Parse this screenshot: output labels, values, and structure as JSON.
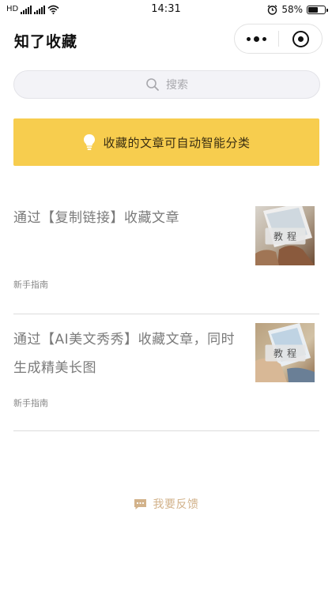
{
  "status_bar": {
    "signal_left_text": "HD",
    "time": "14:31",
    "battery_percent": "58%",
    "battery_level": 0.58,
    "alarm_icon": "alarm-icon",
    "wifi_icon": "wifi-icon"
  },
  "nav": {
    "title": "知了收藏",
    "more_icon": "more-dots-icon",
    "close_icon": "target-close-icon"
  },
  "search": {
    "placeholder": "搜索",
    "icon": "search-icon"
  },
  "banner": {
    "text": "收藏的文章可自动智能分类",
    "icon": "lightbulb-icon",
    "color": "#f7cd4e"
  },
  "articles": [
    {
      "title": "通过【复制链接】收藏文章",
      "tag": "新手指南",
      "thumb_badge": "教程"
    },
    {
      "title": "通过【AI美文秀秀】收藏文章，同时生成精美长图",
      "tag": "新手指南",
      "thumb_badge": "教程"
    }
  ],
  "feedback": {
    "label": "我要反馈",
    "icon": "chat-bubble-icon",
    "color": "#d2b28a"
  }
}
